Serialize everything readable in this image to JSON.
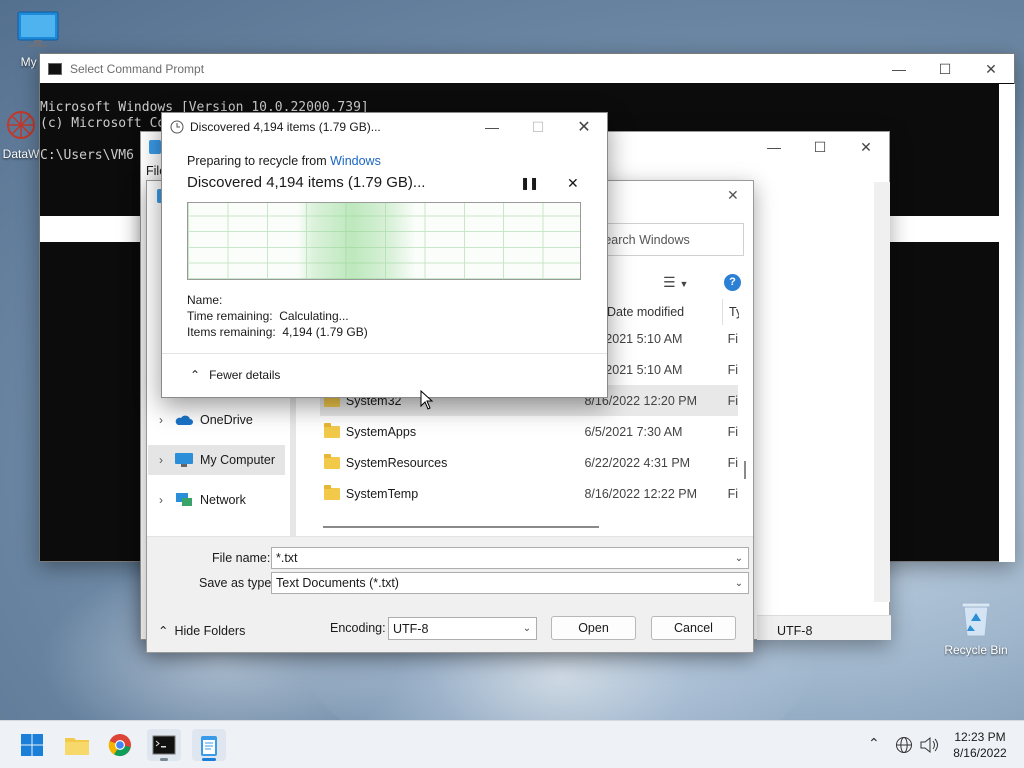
{
  "desktop": {
    "icons": [
      {
        "label": "My Co",
        "icon": "monitor-icon"
      },
      {
        "label": "DataW",
        "icon": "datawave-icon"
      },
      {
        "label": "Recycle Bin",
        "icon": "recycle-bin-icon"
      }
    ]
  },
  "cmd": {
    "title": "Select Command Prompt",
    "lines": [
      "Microsoft Windows [Version 10.0.22000.739]",
      "(c) Microsoft Corporation. All rights reserved.",
      "",
      "C:\\Users\\VM6"
    ]
  },
  "notepad": {
    "menu_file": "File",
    "encoding_status": "UTF-8"
  },
  "open_dialog": {
    "search_placeholder": "Search Windows",
    "column_date": "Date modified",
    "column_type": "Ty",
    "nav": [
      {
        "label": "OneDrive",
        "icon": "onedrive-icon"
      },
      {
        "label": "My Computer",
        "icon": "computer-icon",
        "selected": true
      },
      {
        "label": "Network",
        "icon": "network-icon"
      }
    ],
    "files": [
      {
        "name": "",
        "date": "6/5/2021 5:10 AM",
        "type": "Fi"
      },
      {
        "name": "",
        "date": "6/5/2021 5:10 AM",
        "type": "Fi"
      },
      {
        "name": "System32",
        "date": "8/16/2022 12:20 PM",
        "type": "Fi"
      },
      {
        "name": "SystemApps",
        "date": "6/5/2021 7:30 AM",
        "type": "Fi"
      },
      {
        "name": "SystemResources",
        "date": "6/22/2022 4:31 PM",
        "type": "Fi"
      },
      {
        "name": "SystemTemp",
        "date": "8/16/2022 12:22 PM",
        "type": "Fi"
      }
    ],
    "file_name_label": "File name:",
    "file_name_value": "*.txt",
    "save_as_label": "Save as type:",
    "save_as_value": "Text Documents (*.txt)",
    "hide_folders": "Hide Folders",
    "encoding_label": "Encoding:",
    "encoding_value": "UTF-8",
    "open_button": "Open",
    "cancel_button": "Cancel"
  },
  "progress": {
    "title": "Discovered 4,194 items (1.79 GB)...",
    "preparing_prefix": "Preparing to recycle from",
    "preparing_link": "Windows",
    "heading": "Discovered 4,194 items (1.79 GB)...",
    "name_label": "Name:",
    "time_label": "Time remaining:",
    "time_value": "Calculating...",
    "items_label": "Items remaining:",
    "items_value": "4,194 (1.79 GB)",
    "fewer_details": "Fewer details"
  },
  "taskbar": {
    "apps": [
      "start-icon",
      "file-explorer-icon",
      "chrome-icon",
      "terminal-icon",
      "notepad-icon"
    ],
    "time": "12:23 PM",
    "date": "8/16/2022"
  }
}
